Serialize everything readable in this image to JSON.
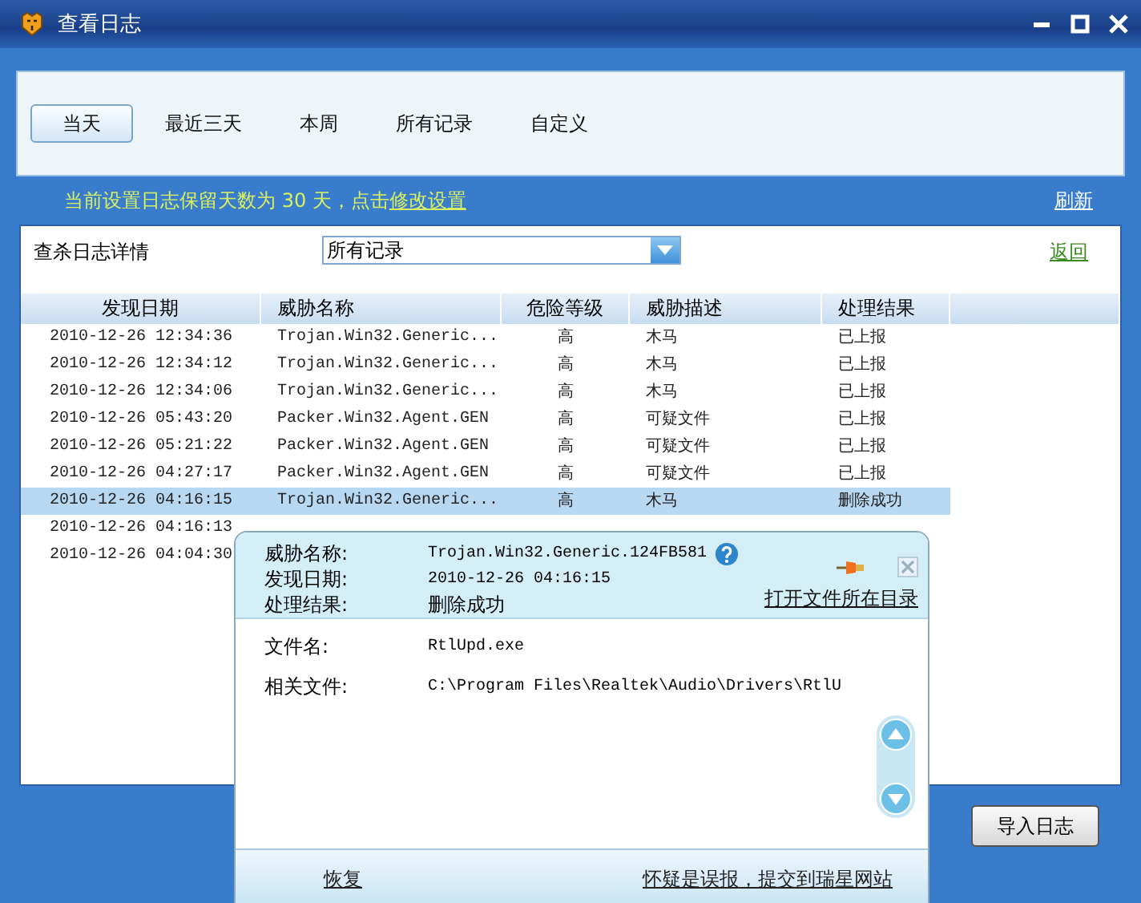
{
  "window": {
    "title": "查看日志"
  },
  "tabs": [
    {
      "label": "当天",
      "selected": true
    },
    {
      "label": "最近三天",
      "selected": false
    },
    {
      "label": "本周",
      "selected": false
    },
    {
      "label": "所有记录",
      "selected": false
    },
    {
      "label": "自定义",
      "selected": false
    }
  ],
  "notice": {
    "text": "当前设置日志保留天数为 30 天，点击",
    "link": "修改设置"
  },
  "refresh_link": "刷新",
  "filter": {
    "label": "查杀日志详情",
    "value": "所有记录"
  },
  "back_link": "返回",
  "table": {
    "columns": [
      "发现日期",
      "威胁名称",
      "危险等级",
      "威胁描述",
      "处理结果"
    ],
    "rows": [
      {
        "cells": [
          "2010-12-26 12:34:36",
          "Trojan.Win32.Generic...",
          "高",
          "木马",
          "已上报"
        ],
        "selected": false
      },
      {
        "cells": [
          "2010-12-26 12:34:12",
          "Trojan.Win32.Generic...",
          "高",
          "木马",
          "已上报"
        ],
        "selected": false
      },
      {
        "cells": [
          "2010-12-26 12:34:06",
          "Trojan.Win32.Generic...",
          "高",
          "木马",
          "已上报"
        ],
        "selected": false
      },
      {
        "cells": [
          "2010-12-26 05:43:20",
          "Packer.Win32.Agent.GEN",
          "高",
          "可疑文件",
          "已上报"
        ],
        "selected": false
      },
      {
        "cells": [
          "2010-12-26 05:21:22",
          "Packer.Win32.Agent.GEN",
          "高",
          "可疑文件",
          "已上报"
        ],
        "selected": false
      },
      {
        "cells": [
          "2010-12-26 04:27:17",
          "Packer.Win32.Agent.GEN",
          "高",
          "可疑文件",
          "已上报"
        ],
        "selected": false
      },
      {
        "cells": [
          "2010-12-26 04:16:15",
          "Trojan.Win32.Generic...",
          "高",
          "木马",
          "删除成功"
        ],
        "selected": true
      },
      {
        "cells": [
          "2010-12-26 04:16:13"
        ],
        "selected": false
      },
      {
        "cells": [
          "2010-12-26 04:04:30"
        ],
        "selected": false
      }
    ]
  },
  "detail_popup": {
    "fields": [
      {
        "label": "威胁名称:",
        "value": "Trojan.Win32.Generic.124FB581"
      },
      {
        "label": "发现日期:",
        "value": "2010-12-26 04:16:15"
      },
      {
        "label": "处理结果:",
        "value": "删除成功"
      }
    ],
    "open_folder_link": "打开文件所在目录",
    "file_fields": [
      {
        "label": "文件名:",
        "value": "RtlUpd.exe"
      },
      {
        "label": "相关文件:",
        "value": "C:\\Program Files\\Realtek\\Audio\\Drivers\\RtlU"
      }
    ],
    "footer_links": [
      "恢复",
      "怀疑是误报，提交到瑞星网站"
    ]
  },
  "import_button": "导入日志"
}
